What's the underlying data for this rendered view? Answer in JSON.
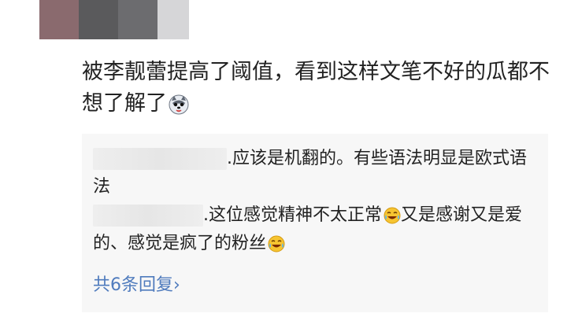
{
  "post": {
    "text": "被李靓蕾提高了阈值，看到这样文笔不好的瓜都不想了解了",
    "emoji": "husky-dog-face"
  },
  "replies": [
    {
      "text": ".应该是机翻的。有些语法明显是欧式语法"
    },
    {
      "text_a": ".这位感觉精神不太正常",
      "text_b": "又是感谢又是爱的、感觉是疯了的粉丝",
      "emoji": "laughing-tears"
    }
  ],
  "more_replies": {
    "label": "共6条回复",
    "chevron": "›"
  },
  "colors": {
    "link": "#4f7bbd",
    "reply_bg": "#f7f7f7",
    "text": "#222222"
  }
}
